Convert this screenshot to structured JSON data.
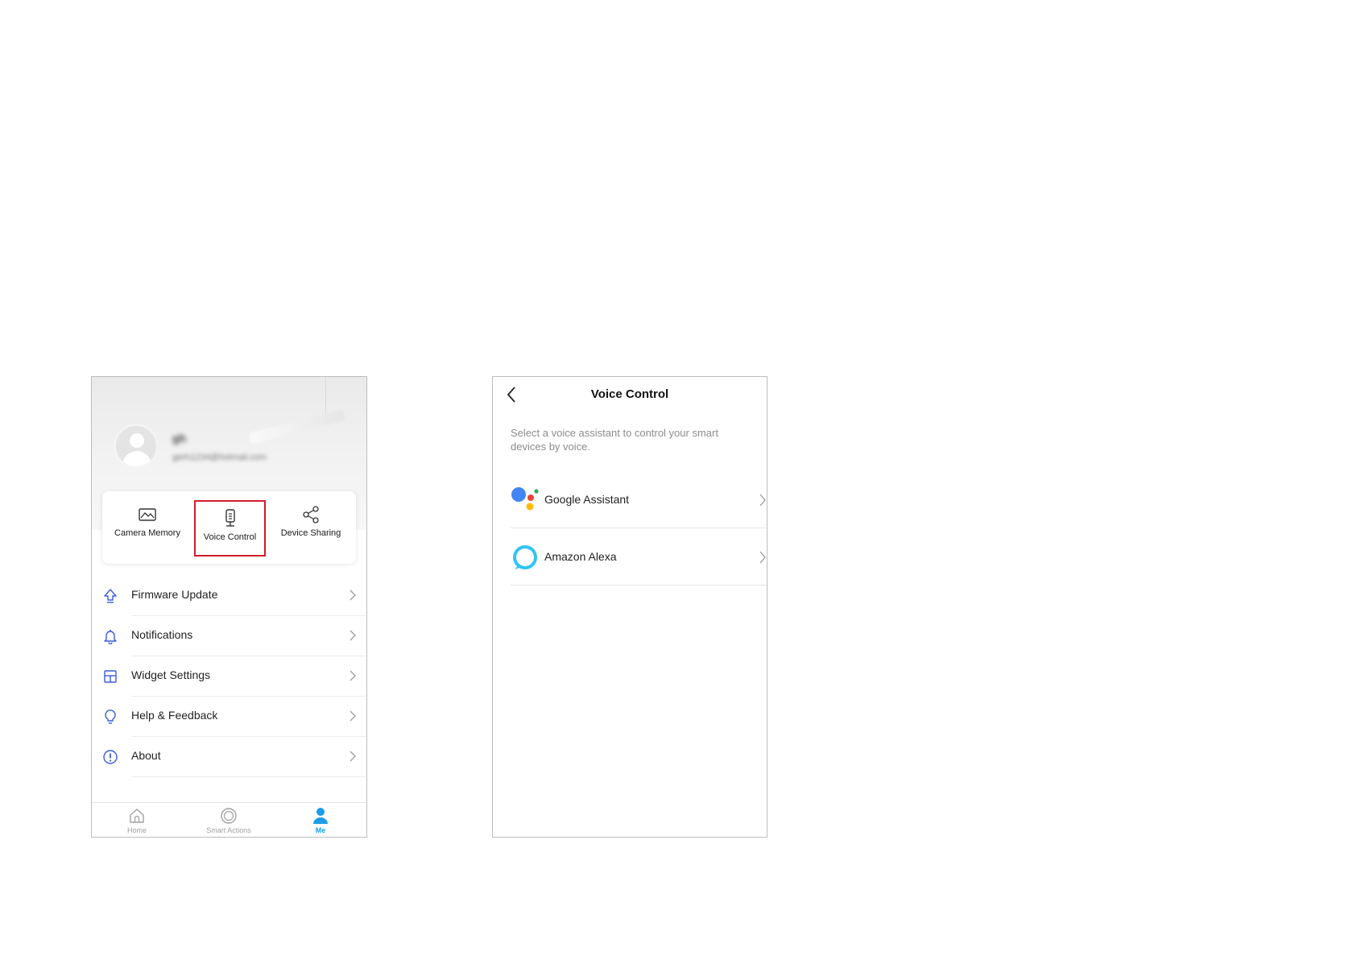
{
  "screen1": {
    "profile": {
      "name": "gh",
      "email": "gerh1234@hotmail.com"
    },
    "quick_actions": [
      {
        "label": "Camera Memory",
        "icon": "picture-icon"
      },
      {
        "label": "Voice Control",
        "icon": "speaker-icon"
      },
      {
        "label": "Device Sharing",
        "icon": "share-icon"
      }
    ],
    "menu": [
      {
        "label": "Firmware Update",
        "icon": "upload-arrow-icon"
      },
      {
        "label": "Notifications",
        "icon": "bell-icon"
      },
      {
        "label": "Widget Settings",
        "icon": "widget-icon"
      },
      {
        "label": "Help & Feedback",
        "icon": "bulb-icon"
      },
      {
        "label": "About",
        "icon": "info-icon"
      }
    ],
    "tabs": [
      {
        "label": "Home",
        "icon": "home-icon"
      },
      {
        "label": "Smart Actions",
        "icon": "circle-icon"
      },
      {
        "label": "Me",
        "icon": "person-icon"
      }
    ],
    "highlight_color": "#d01c2a",
    "accent_color": "#1a9de8",
    "menu_icon_color": "#3b5bdb"
  },
  "screen2": {
    "title": "Voice Control",
    "description": "Select a voice assistant to control your smart devices by voice.",
    "assistants": [
      {
        "label": "Google Assistant",
        "icon": "google-assistant-icon"
      },
      {
        "label": "Amazon Alexa",
        "icon": "alexa-icon"
      }
    ]
  }
}
